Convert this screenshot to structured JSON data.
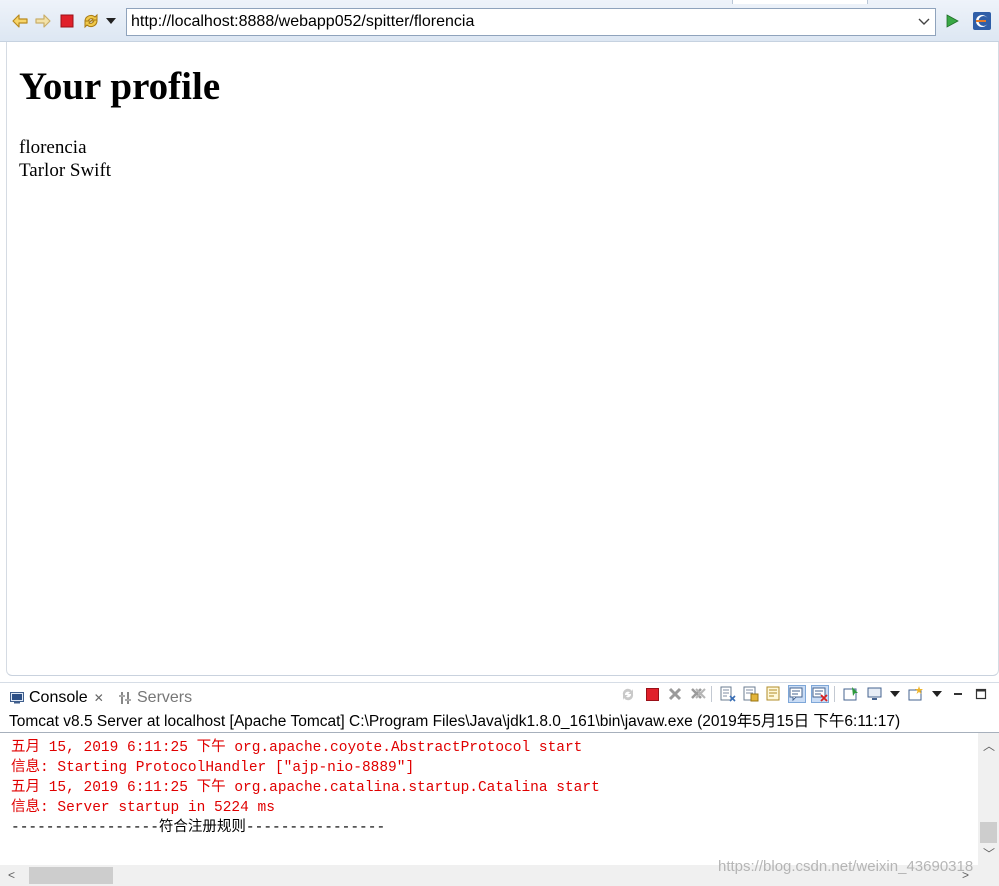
{
  "browser": {
    "url": "http://localhost:8888/webapp052/spitter/florencia"
  },
  "page": {
    "title": "Your profile",
    "username": "florencia",
    "fullname": "Tarlor Swift"
  },
  "panel": {
    "tabs": [
      {
        "label": "Console",
        "active": true
      },
      {
        "label": "Servers",
        "active": false
      }
    ]
  },
  "console": {
    "header": "Tomcat v8.5 Server at localhost [Apache Tomcat] C:\\Program Files\\Java\\jdk1.8.0_161\\bin\\javaw.exe (2019年5月15日 下午6:11:17)",
    "lines": [
      {
        "text": "五月 15, 2019 6:11:25 下午 org.apache.coyote.AbstractProtocol start",
        "color": "#e00000"
      },
      {
        "text": "信息: Starting ProtocolHandler [\"ajp-nio-8889\"]",
        "color": "#e00000"
      },
      {
        "text": "五月 15, 2019 6:11:25 下午 org.apache.catalina.startup.Catalina start",
        "color": "#e00000"
      },
      {
        "text": "信息: Server startup in 5224 ms",
        "color": "#e00000"
      },
      {
        "text": "-----------------符合注册规则----------------",
        "color": "#000000"
      }
    ]
  },
  "watermark": "https://blog.csdn.net/weixin_43690318",
  "icons": {
    "back": "back-arrow-icon",
    "forward": "forward-arrow-icon",
    "stop": "stop-icon",
    "refresh": "refresh-icon",
    "menu": "chevron-down-icon",
    "go": "go-icon",
    "eclipse": "eclipse-icon"
  }
}
